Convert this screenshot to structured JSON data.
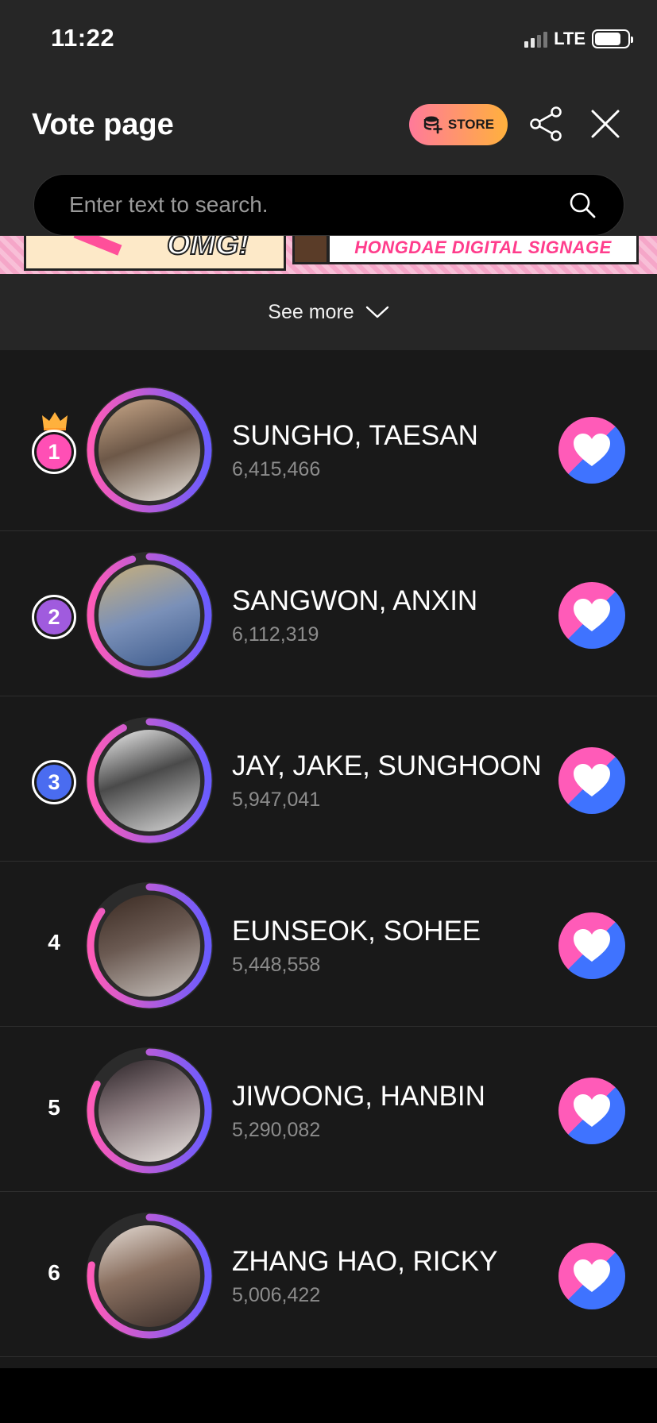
{
  "status_bar": {
    "time": "11:22",
    "network": "LTE"
  },
  "header": {
    "title": "Vote page",
    "store_label": "STORE",
    "search_placeholder": "Enter text to search."
  },
  "banner": {
    "omg_text": "OMG!",
    "caption": "HONGDAE DIGITAL SIGNAGE"
  },
  "see_more_label": "See more",
  "colors": {
    "rank1": "#ff4fb5",
    "rank2": "#a05bde",
    "rank3": "#4a6cf0",
    "ring_gradient_start": "#ff5bb8",
    "ring_gradient_end": "#6a5cff",
    "vote_pink": "#ff5bb8",
    "vote_blue": "#3f73ff",
    "store_gradient": [
      "#ff7a9a",
      "#ffb13d"
    ]
  },
  "rankings": [
    {
      "rank": "1",
      "name": "SUNGHO, TAESAN",
      "votes": "6,415,466",
      "progress": 1.0
    },
    {
      "rank": "2",
      "name": "SANGWON, ANXIN",
      "votes": "6,112,319",
      "progress": 0.953
    },
    {
      "rank": "3",
      "name": "JAY, JAKE, SUNGHOON",
      "votes": "5,947,041",
      "progress": 0.927
    },
    {
      "rank": "4",
      "name": "EUNSEOK, SOHEE",
      "votes": "5,448,558",
      "progress": 0.849
    },
    {
      "rank": "5",
      "name": "JIWOONG, HANBIN",
      "votes": "5,290,082",
      "progress": 0.825
    },
    {
      "rank": "6",
      "name": "ZHANG HAO, RICKY",
      "votes": "5,006,422",
      "progress": 0.78
    }
  ],
  "icons": {
    "store": "coin-stack-plus-icon",
    "share": "share-icon",
    "close": "close-icon",
    "search": "search-icon",
    "see_more": "chevron-down-icon",
    "top_rank": "crown-icon",
    "vote": "heart-icon"
  }
}
